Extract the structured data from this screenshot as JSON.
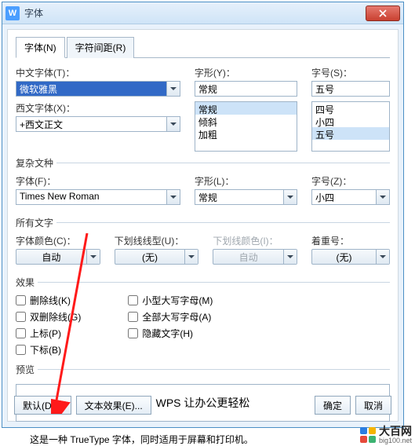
{
  "window": {
    "title": "字体"
  },
  "tabs": {
    "font": "字体(N)",
    "spacing": "字符间距(R)"
  },
  "section_cn": {
    "font_label": "中文字体(T)：",
    "font_value": "微软雅黑",
    "style_label": "字形(Y)：",
    "style_value": "常规",
    "style_options": [
      "常规",
      "倾斜",
      "加粗"
    ],
    "size_label": "字号(S)：",
    "size_value": "五号",
    "size_options": [
      "四号",
      "小四",
      "五号"
    ]
  },
  "section_west": {
    "label": "西文字体(X)：",
    "value": "+西文正文"
  },
  "complex": {
    "legend": "复杂文种",
    "font_label": "字体(F)：",
    "font_value": "Times New Roman",
    "style_label": "字形(L)：",
    "style_value": "常规",
    "size_label": "字号(Z)：",
    "size_value": "小四"
  },
  "alltext": {
    "legend": "所有文字",
    "color_label": "字体颜色(C)：",
    "color_value": "自动",
    "uline_label": "下划线线型(U)：",
    "uline_value": "(无)",
    "ucolor_label": "下划线颜色(I)：",
    "ucolor_value": "自动",
    "emph_label": "着重号：",
    "emph_value": "(无)"
  },
  "effects": {
    "legend": "效果",
    "strike": "删除线(K)",
    "dbl_strike": "双删除线(G)",
    "super": "上标(P)",
    "sub": "下标(B)",
    "smallcaps": "小型大写字母(M)",
    "allcaps": "全部大写字母(A)",
    "hidden": "隐藏文字(H)"
  },
  "preview": {
    "legend": "预览",
    "text": "WPS 让办公更轻松"
  },
  "note": "这是一种 TrueType 字体，同时适用于屏幕和打印机。",
  "buttons": {
    "default": "默认(D)...",
    "texteffect": "文本效果(E)...",
    "ok": "确定",
    "cancel": "取消"
  },
  "watermark": {
    "brand": "大百网",
    "url": "big100.net"
  }
}
